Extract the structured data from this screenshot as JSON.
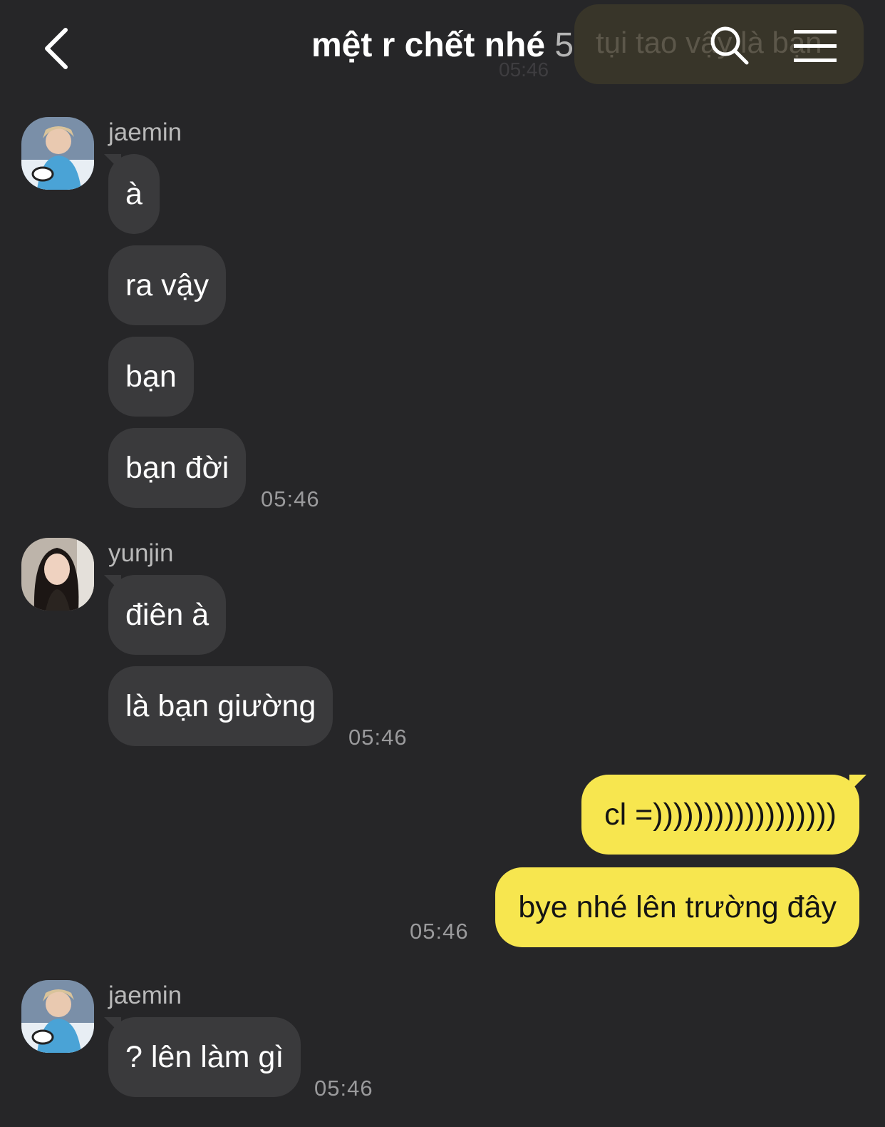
{
  "header": {
    "title": "mệt r chết nhé",
    "member_count": "5",
    "ghost_bubble_text": "tụi tao vậy là bạn",
    "ghost_time": "05:46"
  },
  "icons": {
    "back": "chevron-left-icon",
    "search": "search-icon",
    "menu": "hamburger-menu-icon"
  },
  "colors": {
    "background": "#262628",
    "incoming_bubble": "#3a3a3c",
    "outgoing_bubble": "#f7e64f",
    "timestamp": "#9a9a9c"
  },
  "groups": [
    {
      "sender": "jaemin",
      "messages": [
        "à",
        "ra vậy",
        "bạn",
        "bạn đời"
      ],
      "time": "05:46"
    },
    {
      "sender": "yunjin",
      "messages": [
        "điên à",
        "là bạn giường"
      ],
      "time": "05:46"
    },
    {
      "sender": "me",
      "messages": [
        "cl =))))))))))))))))))",
        "bye nhé lên trường đây"
      ],
      "time": "05:46"
    },
    {
      "sender": "jaemin",
      "messages": [
        "? lên làm gì"
      ],
      "time": "05:46"
    }
  ]
}
